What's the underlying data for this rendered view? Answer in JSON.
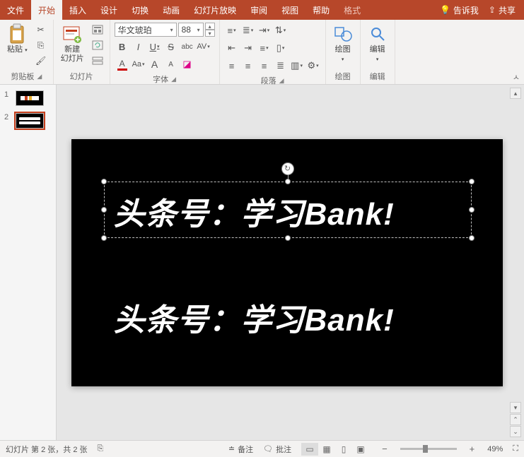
{
  "tabs": {
    "file": "文件",
    "home": "开始",
    "insert": "插入",
    "design": "设计",
    "transition": "切换",
    "animation": "动画",
    "slideshow": "幻灯片放映",
    "review": "审阅",
    "view": "视图",
    "help": "帮助",
    "format": "格式"
  },
  "titlebar": {
    "tellme": "告诉我",
    "share": "共享"
  },
  "ribbon": {
    "clipboard": {
      "paste": "粘贴",
      "group": "剪贴板"
    },
    "slides": {
      "new": "新建\n幻灯片",
      "group": "幻灯片"
    },
    "font": {
      "name": "华文琥珀",
      "size": "88",
      "group": "字体",
      "bold": "B",
      "italic": "I",
      "underline": "U",
      "strike": "S",
      "shadow": "abc",
      "spacing": "AV",
      "fontcolor": "A",
      "case": "Aa",
      "grow": "A",
      "shrink": "A",
      "clear": "◢"
    },
    "paragraph": {
      "group": "段落"
    },
    "drawing": {
      "label": "绘图",
      "group": "绘图"
    },
    "editing": {
      "label": "编辑",
      "group": "编辑"
    }
  },
  "thumbs": [
    {
      "num": "1",
      "active": false
    },
    {
      "num": "2",
      "active": true
    }
  ],
  "slide": {
    "text1": "头条号：学习Bank!",
    "text2": "头条号：学习Bank!"
  },
  "status": {
    "slideinfo": "幻灯片 第 2 张，共 2 张",
    "notes": "备注",
    "comments": "批注",
    "zoom": "49%"
  }
}
